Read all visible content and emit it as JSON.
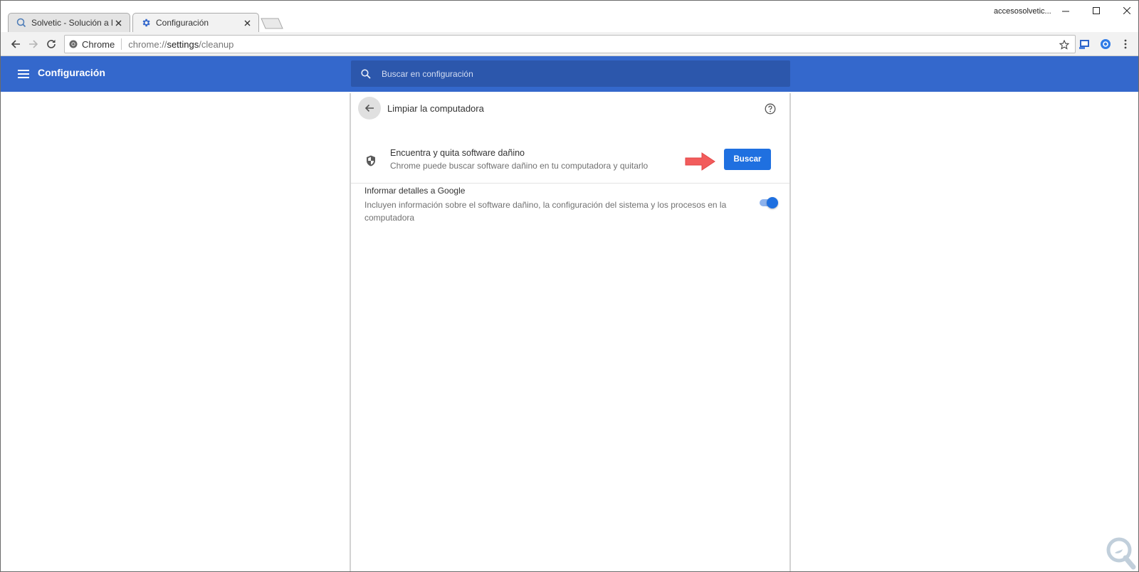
{
  "tabs": [
    {
      "title": "Solvetic - Solución a los p",
      "favicon": "solvetic-favicon-icon",
      "active": false
    },
    {
      "title": "Configuración",
      "favicon": "gear-icon",
      "active": true
    }
  ],
  "window": {
    "profile_name": "accesosolvetic...",
    "buttons": [
      "minimize-icon",
      "maximize-icon",
      "close-icon"
    ]
  },
  "toolbar": {
    "site_chip_label": "Chrome",
    "url_scheme": "chrome://",
    "url_host": "settings",
    "url_path": "/cleanup"
  },
  "settings_header": {
    "title": "Configuración",
    "search_placeholder": "Buscar en configuración",
    "color": "#3468cc"
  },
  "page": {
    "title": "Limpiar la computadora",
    "find": {
      "title": "Encuentra y quita software dañino",
      "description": "Chrome puede buscar software dañino en tu computadora y quitarlo",
      "button_label": "Buscar"
    },
    "report": {
      "title": "Informar detalles a Google",
      "description": "Incluyen información sobre el software dañino, la configuración del sistema y los procesos en la computadora",
      "toggle_on": true
    }
  },
  "colors": {
    "accent": "#1f70e0",
    "annotation_arrow": "#f25c5c"
  }
}
